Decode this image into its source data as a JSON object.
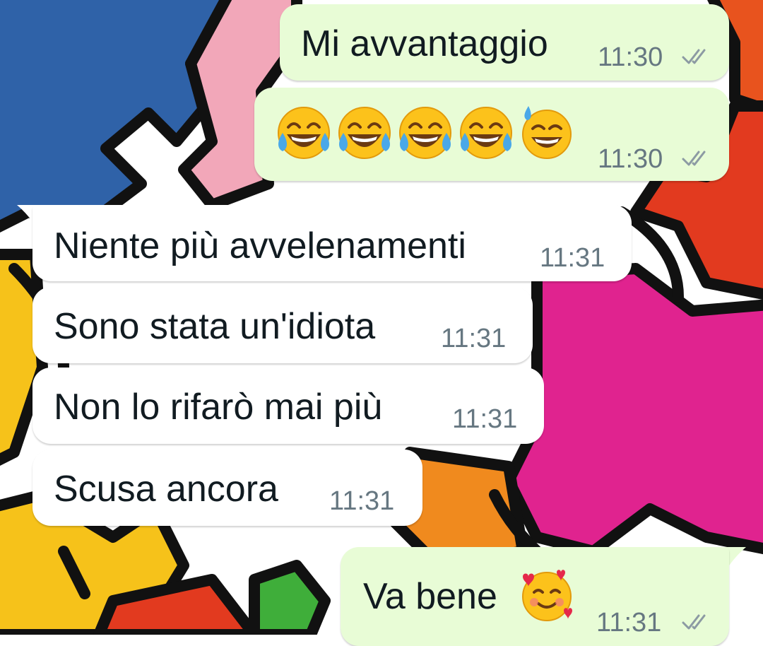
{
  "chat": {
    "messages": [
      {
        "direction": "out",
        "text": "Mi avvantaggio",
        "time": "11:30",
        "status": "read-ticks-icon"
      },
      {
        "direction": "out",
        "emojis": [
          "laughing-crying-emoji",
          "laughing-crying-emoji",
          "laughing-crying-emoji",
          "laughing-crying-emoji",
          "grinning-sweat-emoji"
        ],
        "time": "11:30",
        "status": "read-ticks-icon"
      },
      {
        "direction": "in",
        "text": "Niente più avvelenamenti",
        "time": "11:31"
      },
      {
        "direction": "in",
        "text": "Sono stata un'idiota",
        "time": "11:31"
      },
      {
        "direction": "in",
        "text": "Non lo rifarò mai più",
        "time": "11:31"
      },
      {
        "direction": "in",
        "text": "Scusa ancora",
        "time": "11:31"
      },
      {
        "direction": "out",
        "text": "Va bene",
        "emoji": "smiling-hearts-emoji",
        "time": "11:31",
        "status": "read-ticks-icon"
      }
    ]
  },
  "colors": {
    "outgoing_bubble": "#e8fcd6",
    "incoming_bubble": "#ffffff",
    "message_text": "#111b21",
    "timestamp": "#667781",
    "ticks": "#8c9aa3"
  }
}
